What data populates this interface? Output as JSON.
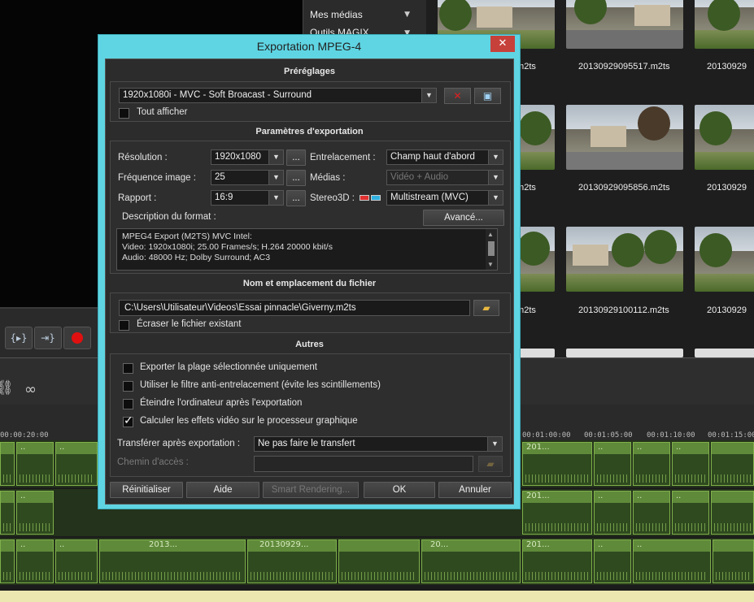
{
  "side_panel": {
    "items": [
      {
        "label": "Mes médias"
      },
      {
        "label": "Outils MAGIX"
      }
    ]
  },
  "media_browser": {
    "files": [
      {
        "name": ".m2ts"
      },
      {
        "name": "20130929095517.m2ts"
      },
      {
        "name": "20130929"
      },
      {
        "name": ".m2ts"
      },
      {
        "name": "20130929095856.m2ts"
      },
      {
        "name": "20130929"
      },
      {
        "name": ".m2ts"
      },
      {
        "name": "20130929100112.m2ts"
      },
      {
        "name": "20130929"
      }
    ]
  },
  "transport": {
    "buttons": [
      {
        "label": "{▸}",
        "name": "play-range-button"
      },
      {
        "label": "⇥}",
        "name": "go-to-marker-button"
      }
    ]
  },
  "timeline": {
    "ticks": [
      "00:00:20:00",
      "00:01:00:00",
      "00:01:05:00",
      "00:01:10:00",
      "00:01:15:00"
    ],
    "clips": {
      "track1": [
        "..",
        "..",
        "..",
        "..",
        "..",
        "..",
        "..",
        "..",
        "201...",
        "..",
        "..",
        ".."
      ],
      "track2": [
        "..",
        "..",
        "..",
        "..",
        "..",
        "..",
        "..",
        "..",
        "201...",
        "..",
        "..",
        ".."
      ],
      "track3": [
        "..",
        "..",
        "2013...",
        "..",
        "20130929...",
        "..",
        "20...",
        "..",
        "201...",
        "..",
        ".."
      ]
    }
  },
  "dialog": {
    "title": "Exportation MPEG-4",
    "close_label": "✕",
    "presets": {
      "heading": "Préréglages",
      "selected": "1920x1080i - MVC - Soft Broacast -  Surround",
      "show_all": "Tout afficher"
    },
    "export_params": {
      "heading": "Paramètres d'exportation",
      "resolution_label": "Résolution :",
      "resolution": "1920x1080",
      "framerate_label": "Fréquence image :",
      "framerate": "25",
      "ratio_label": "Rapport :",
      "ratio": "16:9",
      "ellipsis": "...",
      "interlace_label": "Entrelacement :",
      "interlace": "Champ haut d'abord",
      "media_label": "Médias :",
      "media": "Vidéo + Audio",
      "stereo_label": "Stereo3D :",
      "stereo": "Multistream (MVC)",
      "format_desc_label": "Description du format :",
      "advanced": "Avancé...",
      "description": [
        "MPEG4 Export (M2TS) MVC Intel:",
        "Video: 1920x1080i; 25.00 Frames/s; H.264 20000 kbit/s",
        "Audio: 48000 Hz; Dolby Surround;  AC3"
      ]
    },
    "file": {
      "heading": "Nom et emplacement du fichier",
      "path": "C:\\Users\\Utilisateur\\Videos\\Essai pinnacle\\Giverny.m2ts",
      "overwrite": "Écraser le fichier existant"
    },
    "others": {
      "heading": "Autres",
      "options": [
        {
          "label": "Exporter la plage sélectionnée uniquement",
          "checked": false
        },
        {
          "label": "Utiliser le filtre anti-entrelacement (évite les scintillements)",
          "checked": false
        },
        {
          "label": "Éteindre l'ordinateur après l'exportation",
          "checked": false
        },
        {
          "label": "Calculer les effets vidéo sur le processeur graphique",
          "checked": true
        }
      ],
      "transfer_label": "Transférer après exportation :",
      "transfer": "Ne pas faire le transfert",
      "path_label": "Chemin d'accès :"
    },
    "buttons": {
      "reset": "Réinitialiser",
      "help": "Aide",
      "smart": "Smart Rendering...",
      "ok": "OK",
      "cancel": "Annuler"
    },
    "colors": {
      "title_bar": "#5fd5e3",
      "close": "#c7413b"
    }
  }
}
